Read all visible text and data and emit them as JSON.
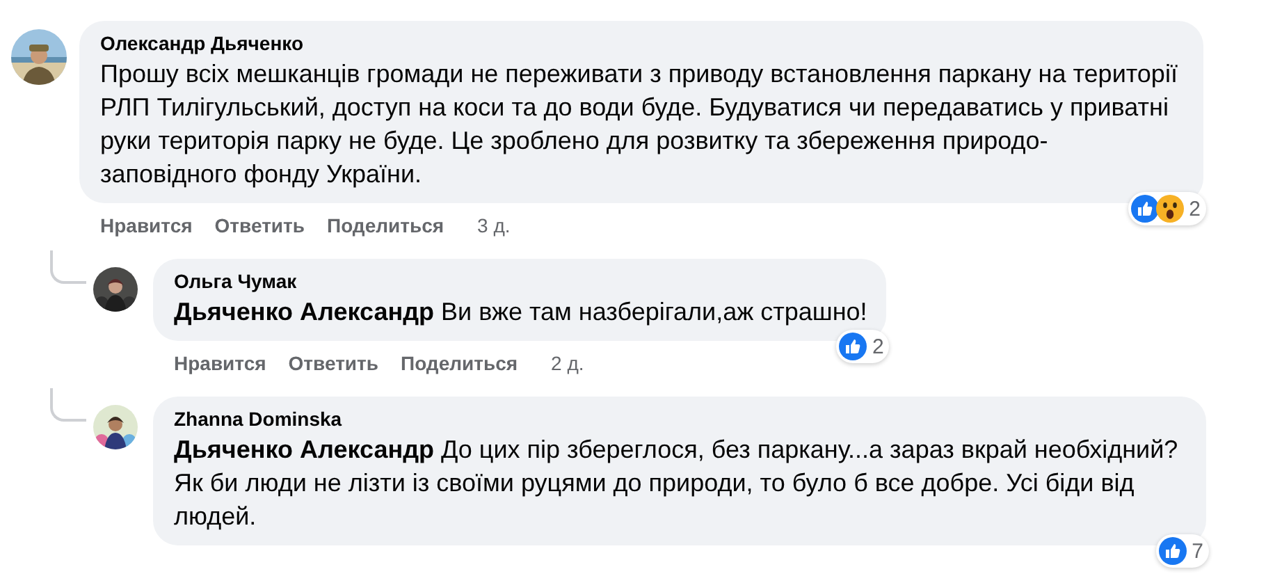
{
  "comments": [
    {
      "author": "Олександр Дьяченко",
      "avatar": {
        "kind": "picture"
      },
      "text": "Прошу всіх мешканців громади не переживати з приводу встановлення паркану на території РЛП Тилігульський, доступ на коси та до води буде. Будуватися чи передаватись у приватні руки територія парку не буде. Це зроблено для розвитку та збереження природо-заповідного фонду України.",
      "reactions": [
        {
          "kind": "like"
        },
        {
          "kind": "wow"
        }
      ],
      "reaction_count": "2",
      "actions": [
        "Нравится",
        "Ответить",
        "Поделиться"
      ],
      "time": "3 д.",
      "replies": [
        {
          "author": "Ольга Чумак",
          "avatar": {
            "kind": "picture"
          },
          "text": "**Дьяченко Александр** Ви вже там назберігали,аж страшно!",
          "reactions": [
            {
              "kind": "like"
            }
          ],
          "reaction_count": "2",
          "actions": [
            "Нравится",
            "Ответить",
            "Поделиться"
          ],
          "time": "2 д."
        },
        {
          "author": "Zhanna Dominska",
          "avatar": {
            "kind": "picture"
          },
          "text": "**Дьяченко Александр** До цих пір збереглося, без паркану...а зараз вкрай необхідний? Як би люди не лізти із своїми руцями до природи, то було б все добре. Усі біди від людей.",
          "reactions": [
            {
              "kind": "like"
            }
          ],
          "reaction_count": "7"
        }
      ]
    }
  ]
}
